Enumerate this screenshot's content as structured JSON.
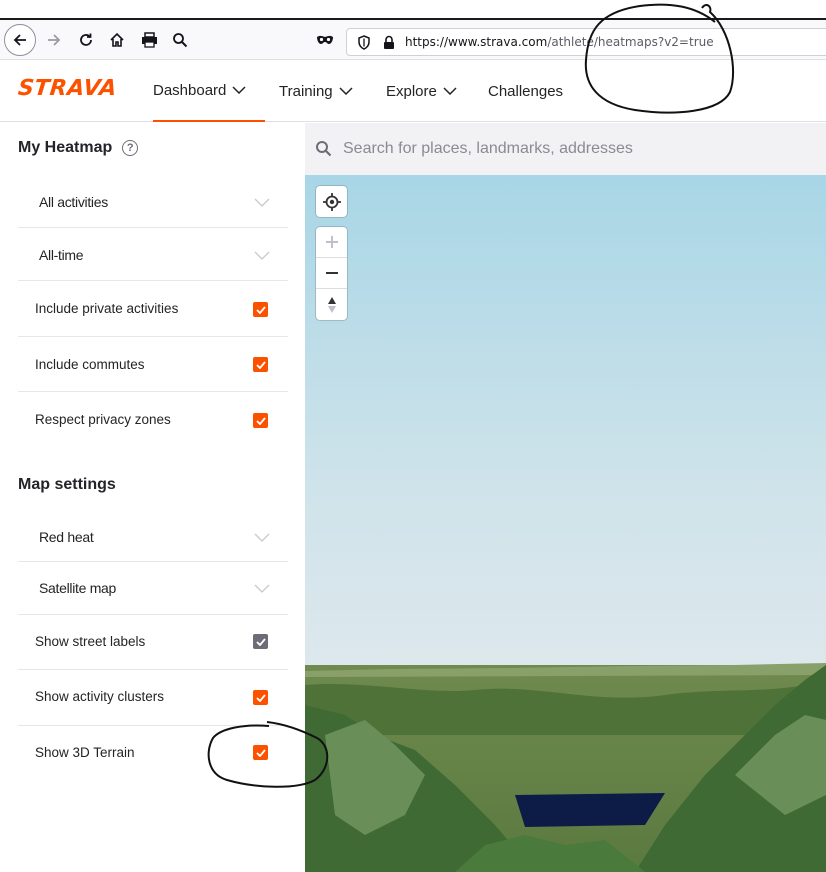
{
  "browser": {
    "url_host": "https://www.strava.com",
    "url_path": "/athlete/heatmaps?v2=true"
  },
  "header": {
    "logo": "STRAVA",
    "nav": [
      {
        "label": "Dashboard",
        "has_menu": true,
        "active": true
      },
      {
        "label": "Training",
        "has_menu": true
      },
      {
        "label": "Explore",
        "has_menu": true
      },
      {
        "label": "Challenges",
        "has_menu": false
      }
    ]
  },
  "sidebar": {
    "my_heatmap_title": "My Heatmap",
    "activity_filter": "All activities",
    "time_filter": "All-time",
    "include_private": {
      "label": "Include private activities",
      "checked": true
    },
    "include_commutes": {
      "label": "Include commutes",
      "checked": true
    },
    "respect_privacy": {
      "label": "Respect privacy zones",
      "checked": true
    },
    "map_settings_title": "Map settings",
    "heat_color": "Red heat",
    "map_type": "Satellite map",
    "show_street_labels": {
      "label": "Show street labels",
      "checked": true
    },
    "show_activity_clusters": {
      "label": "Show activity clusters",
      "checked": true
    },
    "show_3d_terrain": {
      "label": "Show 3D Terrain",
      "checked": true
    }
  },
  "map": {
    "search_placeholder": "Search for places, landmarks, addresses"
  },
  "colors": {
    "brand": "#fc5200",
    "checkbox_gray": "#6d6d78"
  }
}
